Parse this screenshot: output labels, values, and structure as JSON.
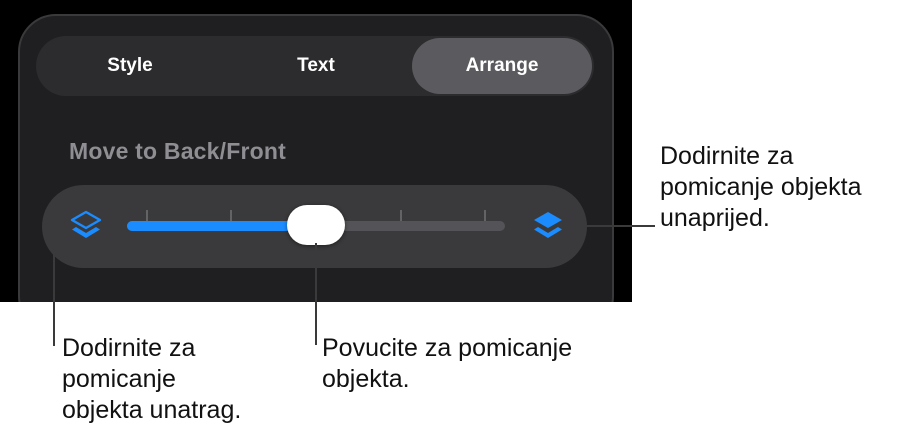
{
  "tabs": [
    {
      "label": "Style",
      "active": false
    },
    {
      "label": "Text",
      "active": false
    },
    {
      "label": "Arrange",
      "active": true
    }
  ],
  "section": {
    "title": "Move to Back/Front"
  },
  "slider": {
    "value_fraction": 0.5,
    "tick_count": 5,
    "left_icon": "send-backward-icon",
    "right_icon": "bring-forward-icon"
  },
  "callouts": {
    "right": "Dodirnite za\npomicanje objekta\nunaprijed.",
    "left": "Dodirnite za\npomicanje\nobjekta unatrag.",
    "middle": "Povucite za pomicanje\nobjekta."
  },
  "colors": {
    "accent": "#1a8cff",
    "screen_bg": "#000000",
    "panel_bg": "#1f1f21",
    "active_tab": "#5b5b5f"
  }
}
